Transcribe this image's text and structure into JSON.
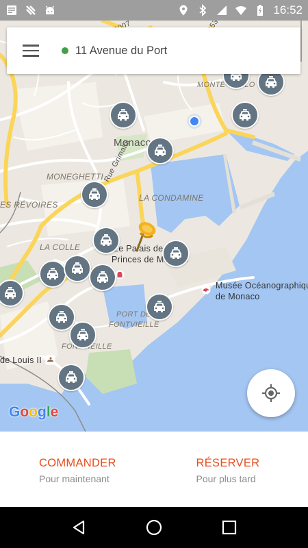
{
  "status_bar": {
    "time": "16:52",
    "left_icons": [
      "document-notification-icon",
      "fax-icon",
      "android-icon"
    ],
    "right_icons": [
      "location-icon",
      "bluetooth-icon",
      "network-icon",
      "wifi-icon",
      "battery-icon"
    ]
  },
  "search": {
    "menu_icon": "hamburger-menu-icon",
    "status_color": "#43a047",
    "address": "11 Avenue du Port"
  },
  "map": {
    "labels": {
      "monaco": "Monaco",
      "moneghetti": "MONEGHETTI",
      "condamine": "LA CONDAMINE",
      "revoires": "ES RÉVOIRES",
      "colle": "LA COLLE",
      "palais_1": "Le Palais des",
      "palais_2": "Princes de Monaco",
      "musee_1": "Musée Océanographique",
      "musee_2": "de Monaco",
      "port_1": "PORT DE",
      "port_2": "FONTVIEILLE",
      "fontvieille": "FONTVIEILLE",
      "louis": "de Louis II",
      "monte_carlo": "MONTE-CARLO",
      "grimaldi": "Rue Grimaldi",
      "road_d6007": "D6007",
      "road_d53": "D53",
      "google": "Google"
    },
    "taxi_count": 19
  },
  "locate_button": {
    "icon": "my-location-icon"
  },
  "actions": {
    "order": {
      "title": "COMMANDER",
      "subtitle": "Pour maintenant"
    },
    "book": {
      "title": "RÉSERVER",
      "subtitle": "Pour plus tard"
    }
  },
  "colors": {
    "accent": "#e84e1b",
    "taxi_marker": "#637483",
    "water": "#a4c6f2",
    "road": "#fbd55a"
  }
}
